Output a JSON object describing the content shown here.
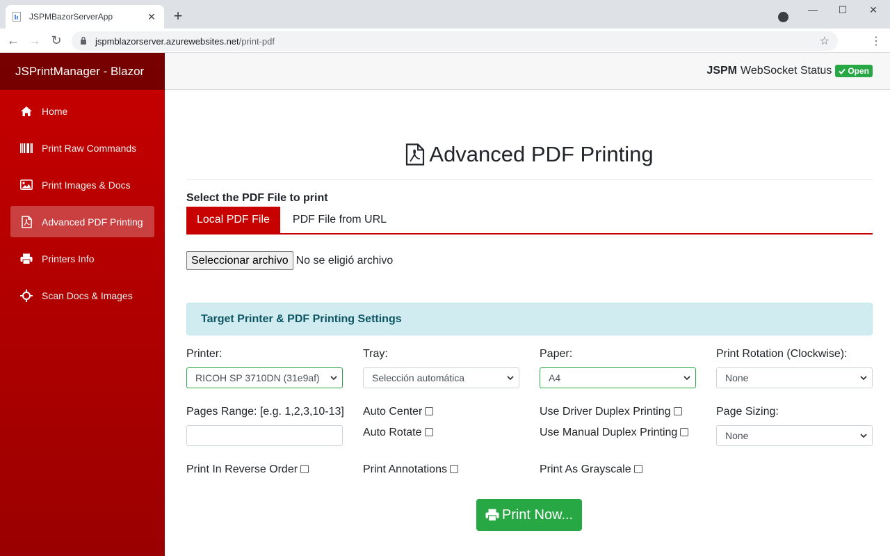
{
  "browser": {
    "tab_title": "JSPMBazorServerApp",
    "close_glyph": "✕",
    "new_tab_glyph": "+",
    "url_host": "jspmblazorserver.azurewebsites.net",
    "url_path": "/print-pdf",
    "minimize_glyph": "—",
    "maximize_glyph": "☐",
    "window_close_glyph": "✕",
    "back_glyph": "←",
    "forward_glyph": "→",
    "reload_glyph": "↻",
    "star_glyph": "☆",
    "menu_glyph": "⋮"
  },
  "sidebar": {
    "brand": "JSPrintManager - Blazor",
    "items": [
      {
        "label": "Home",
        "icon": "home-icon"
      },
      {
        "label": "Print Raw Commands",
        "icon": "barcode-icon"
      },
      {
        "label": "Print Images & Docs",
        "icon": "image-icon"
      },
      {
        "label": "Advanced PDF Printing",
        "icon": "pdf-icon",
        "active": true
      },
      {
        "label": "Printers Info",
        "icon": "printer-icon"
      },
      {
        "label": "Scan Docs & Images",
        "icon": "crosshair-icon"
      }
    ]
  },
  "header": {
    "status_bold": "JSPM",
    "status_text": "WebSocket Status",
    "status_badge": "Open",
    "status_color": "#28a745"
  },
  "main": {
    "title": "Advanced PDF Printing",
    "select_label": "Select the PDF File to print",
    "tabs": [
      {
        "label": "Local PDF File",
        "active": true
      },
      {
        "label": "PDF File from URL",
        "active": false
      }
    ],
    "file_button": "Seleccionar archivo",
    "file_status": "No se eligió archivo",
    "settings_heading": "Target Printer & PDF Printing Settings",
    "printer_label": "Printer:",
    "printer_value": "RICOH SP 3710DN (31e9af)",
    "tray_label": "Tray:",
    "tray_value": "Selección automática",
    "paper_label": "Paper:",
    "paper_value": "A4",
    "rotation_label": "Print Rotation (Clockwise):",
    "rotation_value": "None",
    "pages_range_label": "Pages Range: [e.g. 1,2,3,10-13]",
    "pages_range_value": "",
    "auto_center_label": "Auto Center",
    "auto_rotate_label": "Auto Rotate",
    "driver_duplex_label": "Use Driver Duplex Printing",
    "manual_duplex_label": "Use Manual Duplex Printing",
    "page_sizing_label": "Page Sizing:",
    "page_sizing_value": "None",
    "reverse_order_label": "Print In Reverse Order",
    "annotations_label": "Print Annotations",
    "grayscale_label": "Print As Grayscale",
    "print_button": "Print Now...",
    "accent_color": "#c70000",
    "button_color": "#28a745"
  }
}
